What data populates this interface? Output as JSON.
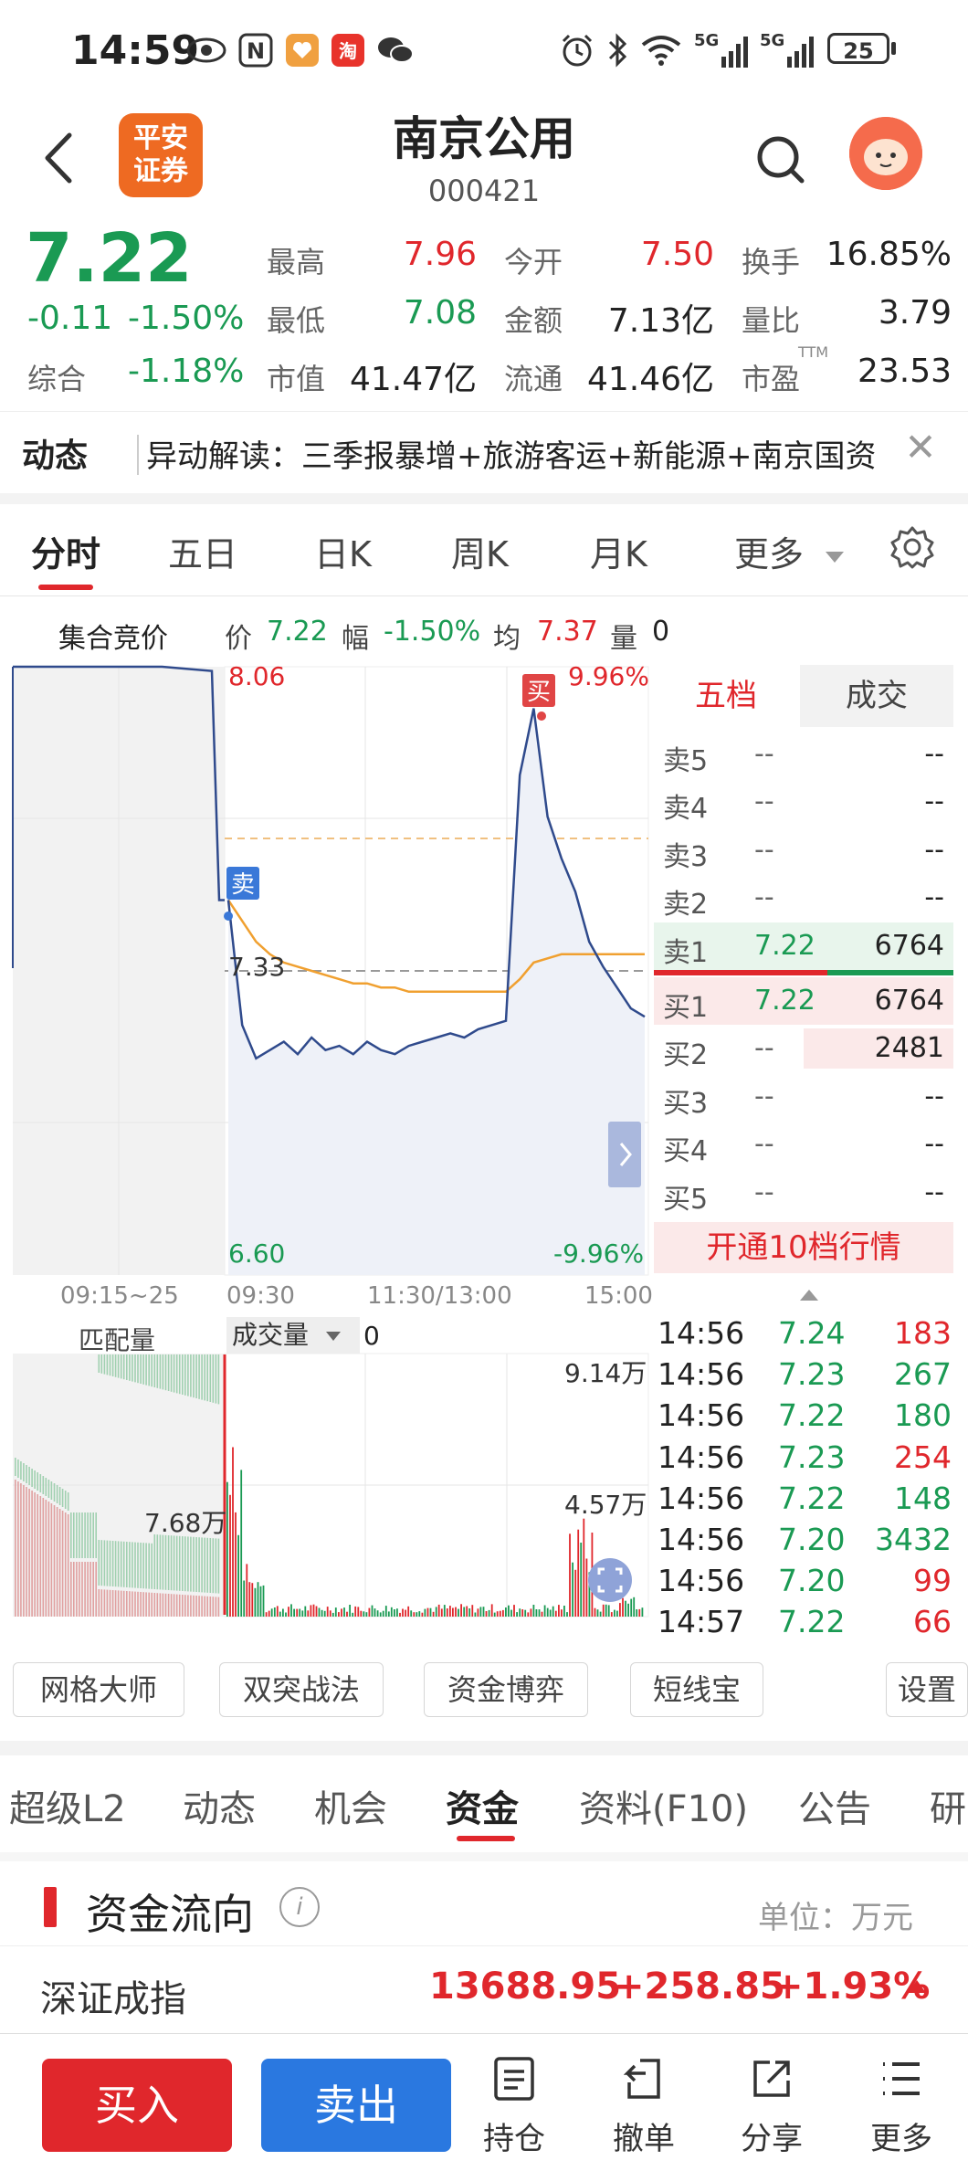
{
  "status_bar": {
    "time": "14:59",
    "signal1": "5G",
    "signal2": "5G",
    "battery": "25",
    "icons": [
      "eye-icon",
      "nfc-icon",
      "app-icon",
      "taobao-icon",
      "wechat-icon",
      "alarm-icon",
      "bluetooth-icon",
      "wifi-icon"
    ]
  },
  "header": {
    "logo_line1": "平安",
    "logo_line2": "证券",
    "stock_name": "南京公用",
    "stock_code": "000421"
  },
  "quote": {
    "price": "7.22",
    "change": "-0.11",
    "change_pct": "-1.50%",
    "composite_label": "综合",
    "composite_val": "-1.18%",
    "high_label": "最高",
    "high_val": "7.96",
    "low_label": "最低",
    "low_val": "7.08",
    "mktcap_label": "市值",
    "mktcap_val": "41.47亿",
    "open_label": "今开",
    "open_val": "7.50",
    "amount_label": "金额",
    "amount_val": "7.13亿",
    "float_label": "流通",
    "float_val": "41.46亿",
    "turnover_label": "换手",
    "turnover_val": "16.85%",
    "volratio_label": "量比",
    "volratio_val": "3.79",
    "pe_label": "市盈",
    "pe_sup": "TTM",
    "pe_val": "23.53"
  },
  "news": {
    "title": "动态",
    "text": "异动解读：三季报暴增+旅游客运+新能源+南京国资",
    "close": "✕"
  },
  "chart_tabs": {
    "items": [
      "分时",
      "五日",
      "日K",
      "周K",
      "月K",
      "更多"
    ],
    "active": "分时"
  },
  "info_row": {
    "auction_label": "集合竞价",
    "price_label": "价",
    "price_val": "7.22",
    "range_label": "幅",
    "range_val": "-1.50%",
    "avg_label": "均",
    "avg_val": "7.37",
    "vol_label": "量",
    "vol_val": "0"
  },
  "chart_data": {
    "type": "line",
    "x_labels": [
      "09:15~25",
      "09:30",
      "11:30/13:00",
      "15:00"
    ],
    "y_max_label": "8.06",
    "y_min_label": "6.60",
    "y_mid_label": "7.33",
    "pct_max_label": "9.96%",
    "pct_min_label": "-9.96%",
    "ylim": [
      6.6,
      8.06
    ],
    "prev_close": 7.33,
    "buy_marker": "买",
    "sell_marker": "卖",
    "series": [
      {
        "name": "价",
        "values": [
          7.5,
          7.2,
          7.12,
          7.14,
          7.16,
          7.13,
          7.17,
          7.14,
          7.15,
          7.13,
          7.16,
          7.14,
          7.13,
          7.15,
          7.16,
          7.17,
          7.18,
          7.17,
          7.19,
          7.2,
          7.21,
          7.8,
          7.96,
          7.7,
          7.6,
          7.52,
          7.4,
          7.34,
          7.29,
          7.24,
          7.22
        ]
      },
      {
        "name": "均",
        "values": [
          7.5,
          7.45,
          7.4,
          7.37,
          7.35,
          7.34,
          7.33,
          7.32,
          7.31,
          7.3,
          7.3,
          7.29,
          7.29,
          7.28,
          7.28,
          7.28,
          7.28,
          7.28,
          7.28,
          7.28,
          7.28,
          7.31,
          7.35,
          7.36,
          7.37,
          7.37,
          7.37,
          7.37,
          7.37,
          7.37,
          7.37
        ]
      }
    ],
    "auction_values": [
      8.06,
      8.06,
      8.06,
      8.06,
      8.05
    ],
    "volume_panel": {
      "match_label": "匹配量",
      "vol_select_label": "成交量",
      "vol_value": "0",
      "vol_max_label": "9.14万",
      "vol_mid_label": "4.57万",
      "auction_vol_label": "7.68万"
    }
  },
  "order_book": {
    "tabs": [
      "五档",
      "成交"
    ],
    "active_tab": "五档",
    "asks": [
      {
        "label": "卖5",
        "price": "--",
        "vol": "--"
      },
      {
        "label": "卖4",
        "price": "--",
        "vol": "--"
      },
      {
        "label": "卖3",
        "price": "--",
        "vol": "--"
      },
      {
        "label": "卖2",
        "price": "--",
        "vol": "--"
      },
      {
        "label": "卖1",
        "price": "7.22",
        "vol": "6764"
      }
    ],
    "bids": [
      {
        "label": "买1",
        "price": "7.22",
        "vol": "6764"
      },
      {
        "label": "买2",
        "price": "--",
        "vol": "2481"
      },
      {
        "label": "买3",
        "price": "--",
        "vol": "--"
      },
      {
        "label": "买4",
        "price": "--",
        "vol": "--"
      },
      {
        "label": "买5",
        "price": "--",
        "vol": "--"
      }
    ],
    "upgrade_label": "开通10档行情"
  },
  "trades": [
    {
      "time": "14:56",
      "price": "7.24",
      "vol": "183",
      "dir": "up"
    },
    {
      "time": "14:56",
      "price": "7.23",
      "vol": "267",
      "dir": "down"
    },
    {
      "time": "14:56",
      "price": "7.22",
      "vol": "180",
      "dir": "down"
    },
    {
      "time": "14:56",
      "price": "7.23",
      "vol": "254",
      "dir": "up"
    },
    {
      "time": "14:56",
      "price": "7.22",
      "vol": "148",
      "dir": "down"
    },
    {
      "time": "14:56",
      "price": "7.20",
      "vol": "3432",
      "dir": "down"
    },
    {
      "time": "14:56",
      "price": "7.20",
      "vol": "99",
      "dir": "up"
    },
    {
      "time": "14:57",
      "price": "7.22",
      "vol": "66",
      "dir": "up"
    }
  ],
  "tools": [
    "网格大师",
    "双突战法",
    "资金博弈",
    "短线宝",
    "设置"
  ],
  "bottom_tabs": {
    "items": [
      "超级L2",
      "动态",
      "机会",
      "资金",
      "资料(F10)",
      "公告",
      "研"
    ],
    "active": "资金"
  },
  "fund_flow": {
    "title": "资金流向",
    "info": "i",
    "unit": "单位：万元",
    "index_name": "深证成指",
    "index_value": "13688.95",
    "index_change": "+258.85",
    "index_pct": "+1.93%"
  },
  "actions": {
    "buy": "买入",
    "sell": "卖出",
    "holdings": "持仓",
    "cancel": "撤单",
    "share": "分享",
    "more": "更多"
  },
  "colors": {
    "up": "#e0272c",
    "down": "#1a9a53",
    "price_line": "#2f4a8c",
    "avg_line": "#f0a030",
    "sell_button": "#2a78e0",
    "logo": "#ee6a22"
  }
}
